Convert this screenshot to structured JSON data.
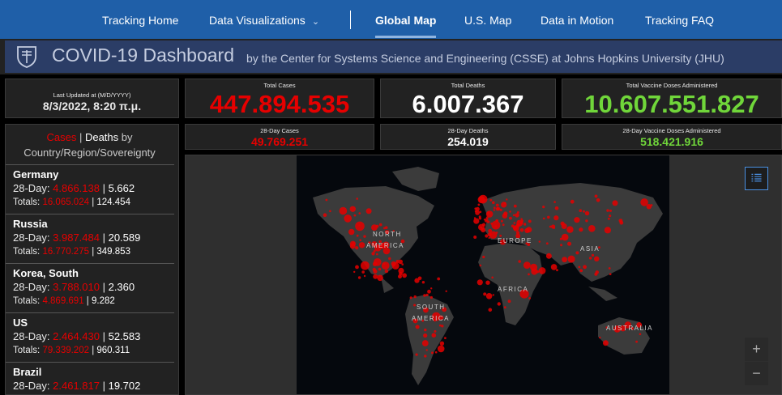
{
  "nav": {
    "items": [
      "Tracking Home",
      "Data Visualizations",
      "Global Map",
      "U.S. Map",
      "Data in Motion",
      "Tracking FAQ"
    ],
    "active": "Global Map"
  },
  "banner": {
    "title": "COVID-19 Dashboard",
    "subtitle": "by the Center for Systems Science and Engineering (CSSE) at Johns Hopkins University (JHU)"
  },
  "updated": {
    "caption": "Last Updated at (M/D/YYYY)",
    "value": "8/3/2022, 8:20 π.μ."
  },
  "stats": {
    "total_cases": {
      "caption": "Total Cases",
      "value": "447.894.535"
    },
    "total_deaths": {
      "caption": "Total Deaths",
      "value": "6.007.367"
    },
    "total_vaccine": {
      "caption": "Total Vaccine Doses Administered",
      "value": "10.607.551.827"
    },
    "cases_28": {
      "caption": "28-Day Cases",
      "value": "49.769.251"
    },
    "deaths_28": {
      "caption": "28-Day Deaths",
      "value": "254.019"
    },
    "vaccine_28": {
      "caption": "28-Day Vaccine Doses Administered",
      "value": "518.421.916"
    }
  },
  "list": {
    "header_cases": "Cases",
    "header_sep": " | ",
    "header_deaths": "Deaths",
    "header_rest": " by",
    "header_line2": "Country/Region/Sovereignty",
    "label_28": "28-Day: ",
    "label_totals": "Totals: ",
    "sep": " | ",
    "rows": [
      {
        "name": "Germany",
        "cases_28": "4.866.138",
        "deaths_28": "5.662",
        "cases_total": "16.065.024",
        "deaths_total": "124.454"
      },
      {
        "name": "Russia",
        "cases_28": "3.987.484",
        "deaths_28": "20.589",
        "cases_total": "16.770.275",
        "deaths_total": "349.853"
      },
      {
        "name": "Korea, South",
        "cases_28": "3.788.010",
        "deaths_28": "2.360",
        "cases_total": "4.869.691",
        "deaths_total": "9.282"
      },
      {
        "name": "US",
        "cases_28": "2.464.430",
        "deaths_28": "52.583",
        "cases_total": "79.339.202",
        "deaths_total": "960.311"
      },
      {
        "name": "Brazil",
        "cases_28": "2.461.817",
        "deaths_28": "19.702",
        "cases_total": "",
        "deaths_total": ""
      }
    ]
  },
  "map": {
    "labels": {
      "north_america": [
        "NORTH",
        "AMERICA"
      ],
      "south_america": [
        "SOUTH",
        "AMERICA"
      ],
      "europe": "EUROPE",
      "asia": "ASIA",
      "africa": "AFRICA",
      "australia": "AUSTRALIA"
    },
    "zoom_in": "+",
    "zoom_out": "−"
  },
  "colors": {
    "cases": "#e60000",
    "deaths": "#ffffff",
    "vaccine": "#70d63a",
    "nav": "#1f5fa8",
    "banner": "#2b3d66"
  }
}
